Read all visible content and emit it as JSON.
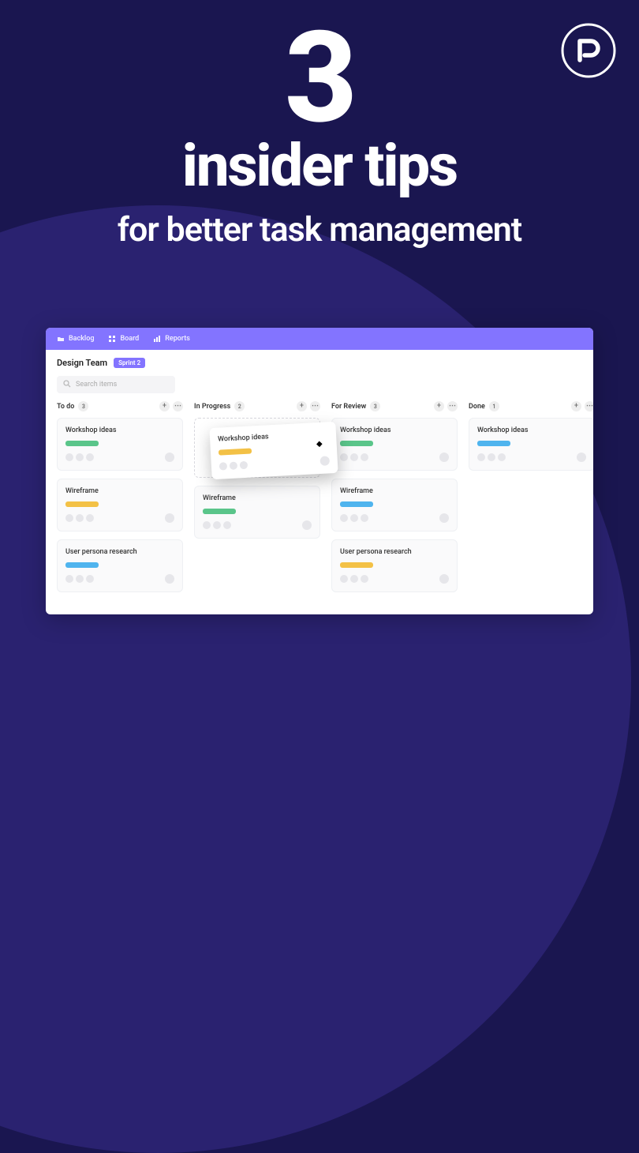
{
  "headline": {
    "number": "3",
    "line1": "insider tips",
    "line2": "for better task management"
  },
  "appbar": {
    "tabs": [
      {
        "label": "Backlog"
      },
      {
        "label": "Board"
      },
      {
        "label": "Reports"
      }
    ]
  },
  "title": {
    "team": "Design Team",
    "sprint": "Sprint 2"
  },
  "search": {
    "placeholder": "Search items"
  },
  "columns": [
    {
      "name": "To do",
      "count": "3",
      "cards": [
        {
          "title": "Workshop ideas",
          "tag": "green"
        },
        {
          "title": "Wireframe",
          "tag": "yellow"
        },
        {
          "title": "User persona research",
          "tag": "blue"
        }
      ]
    },
    {
      "name": "In Progress",
      "count": "2",
      "dragging": {
        "title": "Workshop ideas",
        "tag": "yellow"
      },
      "cards": [
        {
          "title": "Wireframe",
          "tag": "green"
        }
      ]
    },
    {
      "name": "For Review",
      "count": "3",
      "cards": [
        {
          "title": "Workshop ideas",
          "tag": "green"
        },
        {
          "title": "Wireframe",
          "tag": "blue"
        },
        {
          "title": "User persona research",
          "tag": "yellow"
        }
      ]
    },
    {
      "name": "Done",
      "count": "1",
      "cards": [
        {
          "title": "Workshop ideas",
          "tag": "blue"
        }
      ]
    }
  ]
}
